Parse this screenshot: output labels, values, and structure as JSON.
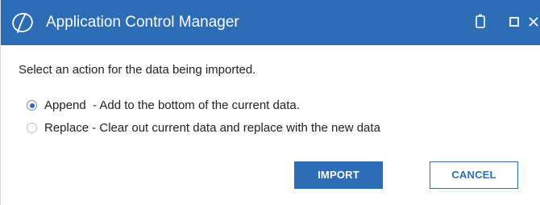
{
  "window": {
    "title": "Application Control Manager",
    "title_bar_color": "#2d6db6",
    "logo_icon": "app-logo-icon",
    "controls": [
      "minimize-icon",
      "maximize-icon",
      "close-icon"
    ]
  },
  "dialog": {
    "prompt": "Select an action for the data being imported.",
    "options": [
      {
        "label": "Append  - Add to the bottom of the current data.",
        "selected": true
      },
      {
        "label": "Replace - Clear out current data and replace with the new data",
        "selected": false
      }
    ],
    "buttons": {
      "import_label": "IMPORT",
      "cancel_label": "CANCEL"
    }
  },
  "colors": {
    "accent": "#2d6db6",
    "text": "#222222"
  }
}
